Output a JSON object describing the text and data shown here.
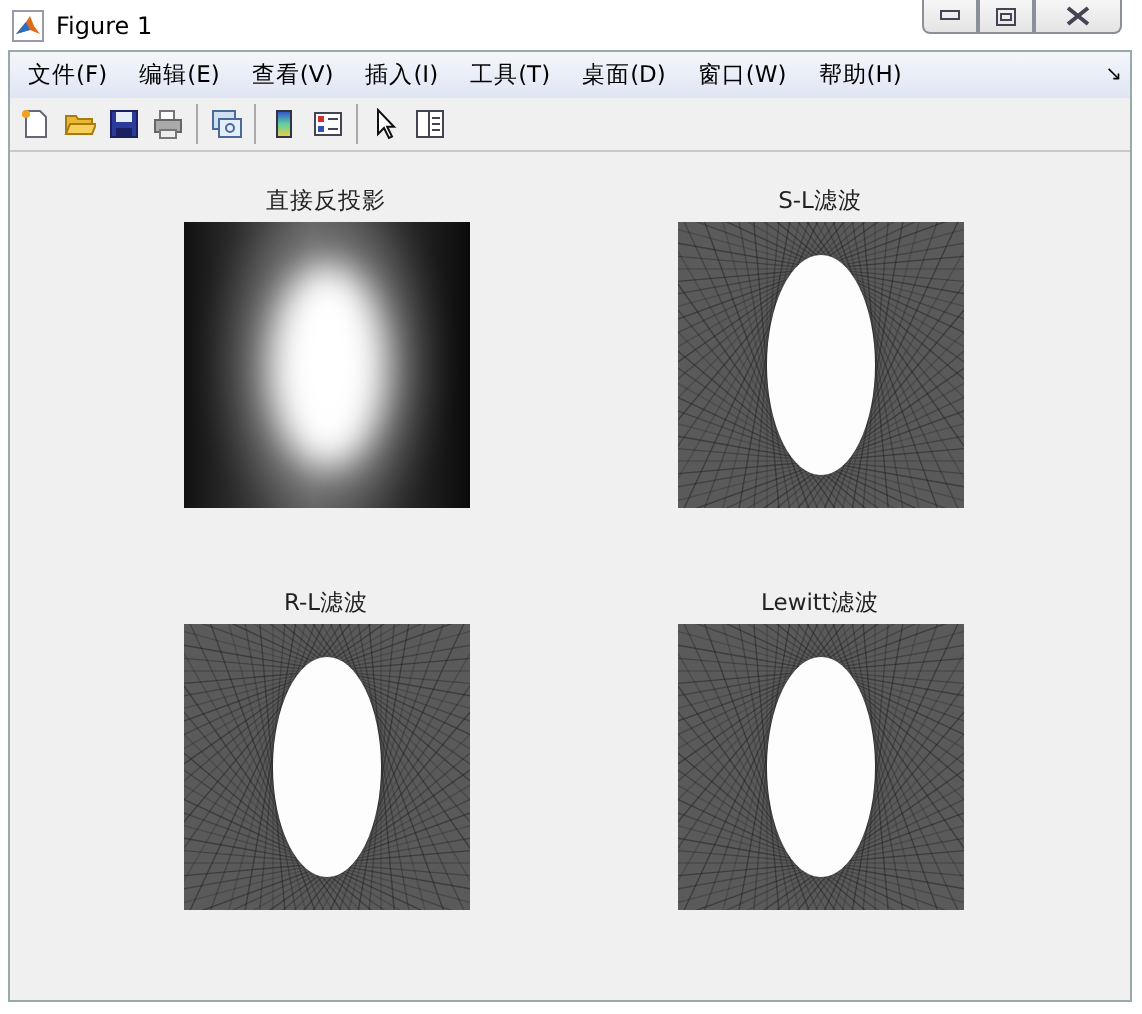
{
  "window": {
    "title": "Figure 1"
  },
  "menu": [
    "文件(F)",
    "编辑(E)",
    "查看(V)",
    "插入(I)",
    "工具(T)",
    "桌面(D)",
    "窗口(W)",
    "帮助(H)"
  ],
  "menu_overflow": "↘",
  "plots": [
    {
      "title": "直接反投影",
      "kind": "backprojection"
    },
    {
      "title": "S-L滤波",
      "kind": "filtered"
    },
    {
      "title": "R-L滤波",
      "kind": "filtered"
    },
    {
      "title": "Lewitt滤波",
      "kind": "filtered"
    }
  ]
}
